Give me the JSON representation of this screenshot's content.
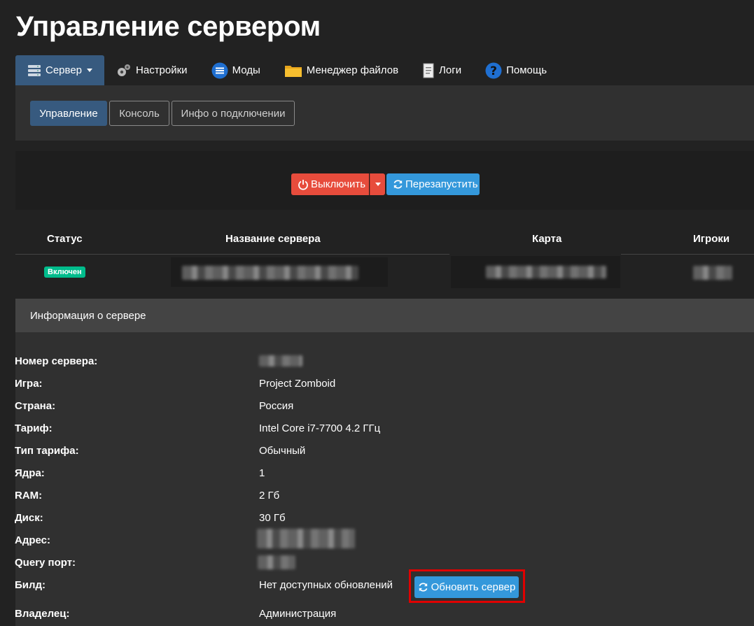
{
  "page": {
    "title": "Управление сервером"
  },
  "main_tabs": [
    {
      "label": "Сервер",
      "icon": "server-icon",
      "active": true
    },
    {
      "label": "Настройки",
      "icon": "gears-icon"
    },
    {
      "label": "Моды",
      "icon": "mods-list-icon"
    },
    {
      "label": "Менеджер файлов",
      "icon": "folder-icon"
    },
    {
      "label": "Логи",
      "icon": "log-document-icon"
    },
    {
      "label": "Помощь",
      "icon": "help-icon"
    }
  ],
  "sub_tabs": [
    {
      "label": "Управление",
      "active": true
    },
    {
      "label": "Консоль"
    },
    {
      "label": "Инфо о подключении"
    }
  ],
  "actions": {
    "shutdown_label": "Выключить",
    "restart_label": "Перезапустить"
  },
  "status_table": {
    "headers": [
      "Статус",
      "Название сервера",
      "Карта",
      "Игроки"
    ],
    "status_badge": "Включен"
  },
  "server_info": {
    "title": "Информация о сервере",
    "rows": [
      {
        "label": "Номер сервера:",
        "value": ""
      },
      {
        "label": "Игра:",
        "value": "Project Zomboid"
      },
      {
        "label": "Страна:",
        "value": "Россия"
      },
      {
        "label": "Тариф:",
        "value": "Intel Core i7-7700 4.2 ГГц"
      },
      {
        "label": "Тип тарифа:",
        "value": "Обычный"
      },
      {
        "label": "Ядра:",
        "value": "1"
      },
      {
        "label": "RAM:",
        "value": "2 Гб"
      },
      {
        "label": "Диск:",
        "value": "30 Гб"
      },
      {
        "label": "Адрес:",
        "value": ""
      },
      {
        "label": "Query порт:",
        "value": ""
      },
      {
        "label": "Билд:",
        "value": "Нет доступных обновлений"
      },
      {
        "label": "Владелец:",
        "value": "Администрация"
      }
    ],
    "update_button": "Обновить сервер"
  },
  "colors": {
    "background": "#222222",
    "primary": "#375a7f",
    "danger": "#e74c3c",
    "info": "#3498db",
    "success": "#00bc8c",
    "highlight": "#e00000"
  }
}
